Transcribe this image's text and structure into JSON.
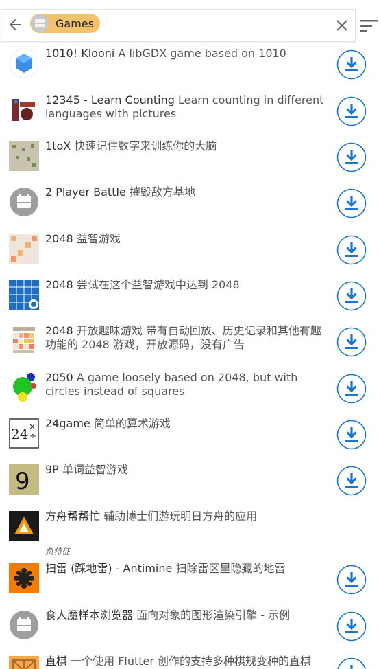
{
  "search": {
    "chip_label": "Games"
  },
  "apps": [
    {
      "name": "1010! Klooni",
      "summary": "A libGDX game based on 1010",
      "icon": "blue-cube-icon"
    },
    {
      "name": "12345 - Learn Counting",
      "summary": "Learn counting in different languages with pictures",
      "icon": "counting-icon"
    },
    {
      "name": "1toX",
      "summary": "快速记住数字来训练你的大脑",
      "icon": "number-grid-icon"
    },
    {
      "name": "2 Player Battle",
      "summary": "摧毁敌方基地",
      "icon": "placeholder-app-icon"
    },
    {
      "name": "2048",
      "summary": "益智游戏",
      "icon": "tiles-2048-icon"
    },
    {
      "name": "2048",
      "summary": "尝试在这个益智游戏中达到 2048",
      "icon": "blue-2048-icon"
    },
    {
      "name": "2048",
      "summary": "开放趣味游戏 带有自动回放、历史记录和其他有趣功能的 2048 游戏，开放源码，没有广告",
      "icon": "colored-2048-icon"
    },
    {
      "name": "2050",
      "summary": "A game loosely based on 2048, but with circles instead of squares",
      "icon": "circles-icon"
    },
    {
      "name": "24game",
      "summary": "简单的算术游戏",
      "icon": "24game-icon"
    },
    {
      "name": "9P",
      "summary": "单词益智游戏",
      "icon": "nine-icon"
    },
    {
      "name": "方舟帮帮忙",
      "summary": "辅助博士们游玩明日方舟的应用",
      "icon": "arknights-icon"
    },
    {
      "name": "扫雷 (踩地雷) - Antimine",
      "summary": "扫除雷区里隐藏的地雷",
      "icon": "minesweeper-icon"
    },
    {
      "name": "食人魔样本浏览器",
      "summary": "面向对象的图形渲染引擎 - 示例",
      "icon": "placeholder-app-icon"
    },
    {
      "name": "直棋",
      "summary": "一个使用 Flutter 创作的支持多种棋规变种的直棋",
      "icon": "board-game-icon"
    }
  ],
  "anti_feature_label": "负特征",
  "colors": {
    "accent": "#1976d2",
    "chip": "#f2c36a"
  }
}
